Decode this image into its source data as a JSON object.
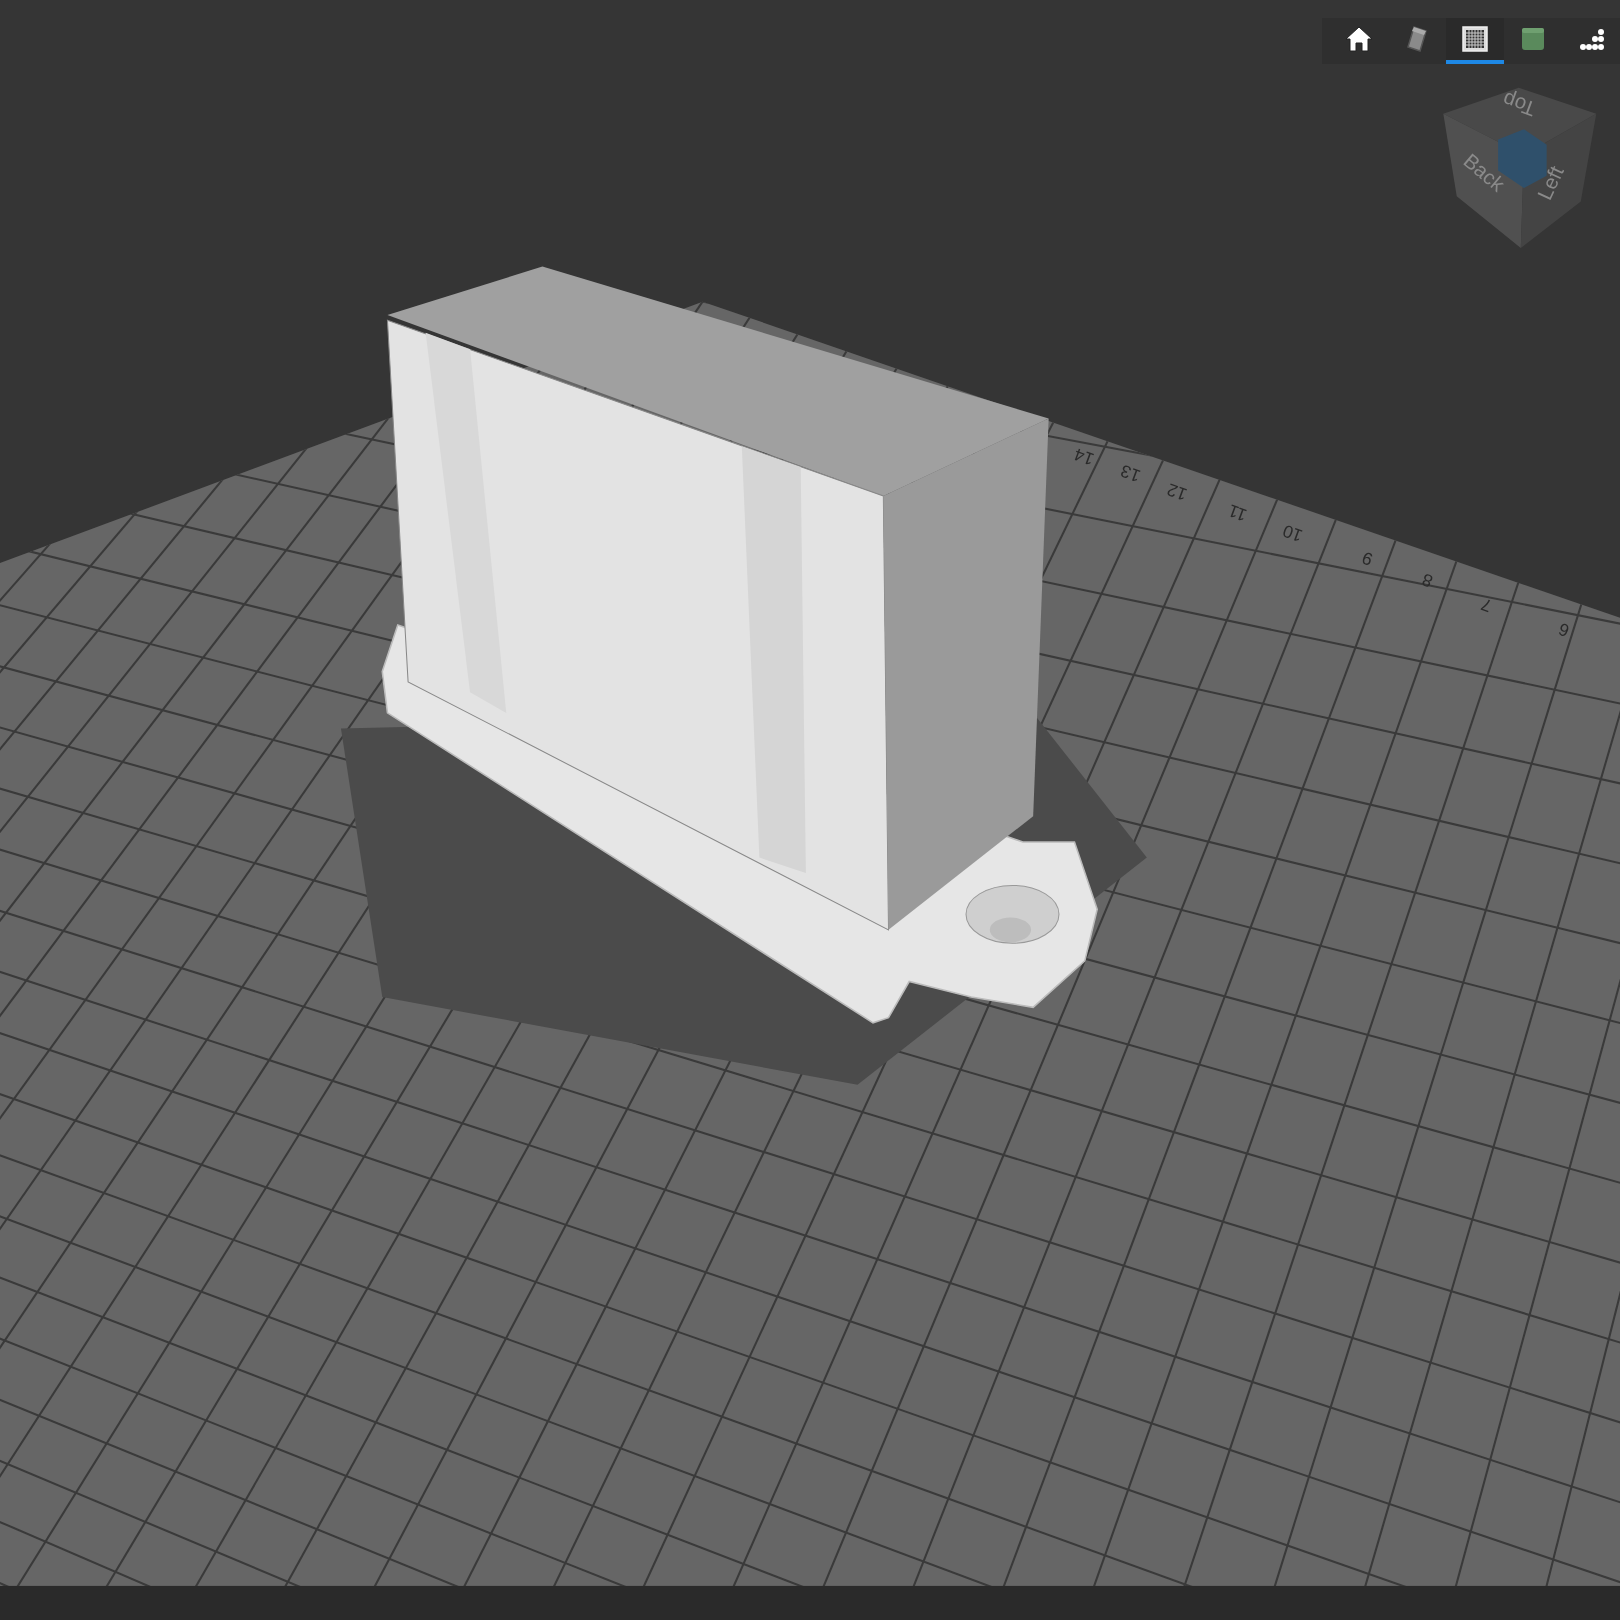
{
  "toolbar": {
    "buttons": [
      {
        "kind": "home",
        "selected": false
      },
      {
        "kind": "solid",
        "selected": false
      },
      {
        "kind": "grid",
        "selected": true
      },
      {
        "kind": "cube",
        "selected": false
      },
      {
        "kind": "dots",
        "selected": false
      }
    ]
  },
  "view_cube": {
    "faces": [
      "Top",
      "Back",
      "Left"
    ]
  },
  "bed": {
    "ruler_labels": [
      "14",
      "13",
      "12",
      "11",
      "10",
      "9",
      "8",
      "7",
      "6"
    ]
  }
}
